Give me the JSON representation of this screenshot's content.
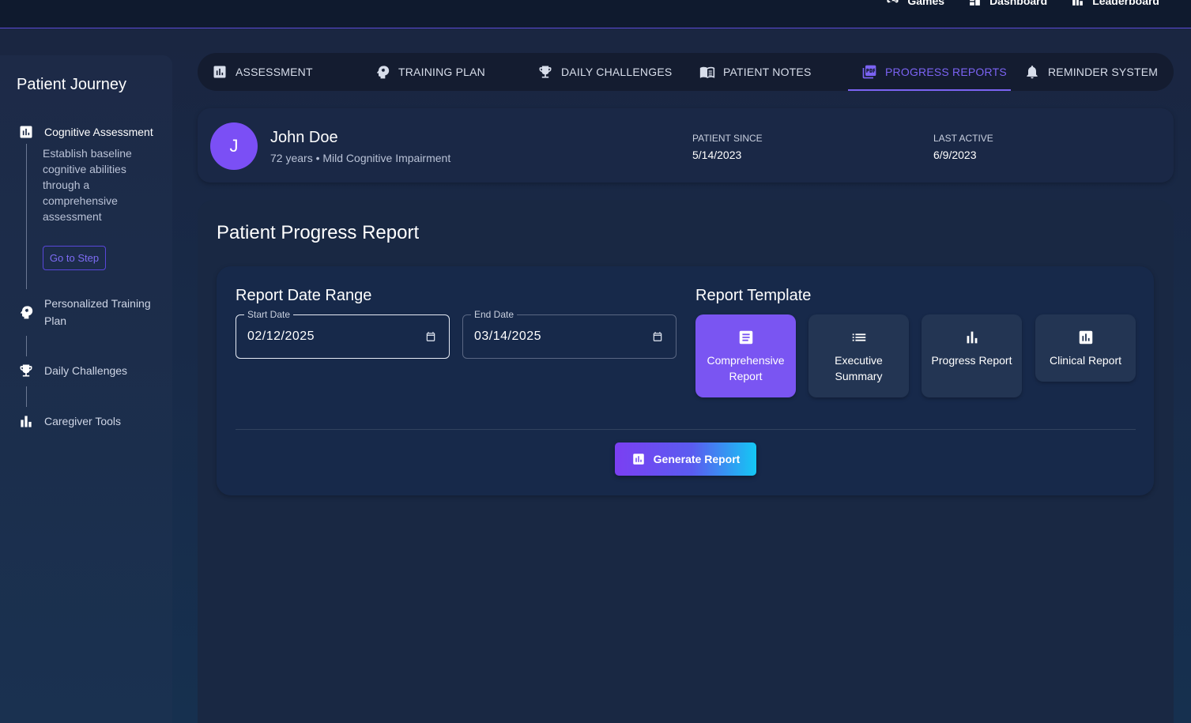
{
  "topnav": {
    "items": [
      {
        "label": "Games",
        "icon": "gamepad-icon"
      },
      {
        "label": "Dashboard",
        "icon": "dashboard-icon"
      },
      {
        "label": "Leaderboard",
        "icon": "leaderboard-icon"
      }
    ]
  },
  "sidebar": {
    "title": "Patient Journey",
    "steps": [
      {
        "label": "Cognitive Assessment",
        "icon": "chart-icon",
        "active": true,
        "description": "Establish baseline cognitive abilities through a comprehensive assessment",
        "button": "Go to Step"
      },
      {
        "label": "Personalized Training Plan",
        "icon": "brain-icon"
      },
      {
        "label": "Daily Challenges",
        "icon": "trophy-icon"
      },
      {
        "label": "Caregiver Tools",
        "icon": "bar-chart-icon"
      }
    ]
  },
  "tabs": [
    {
      "label": "ASSESSMENT",
      "icon": "assessment-icon"
    },
    {
      "label": "TRAINING PLAN",
      "icon": "brain-icon"
    },
    {
      "label": "DAILY CHALLENGES",
      "icon": "trophy-icon"
    },
    {
      "label": "PATIENT NOTES",
      "icon": "book-icon"
    },
    {
      "label": "PROGRESS REPORTS",
      "icon": "pdf-icon",
      "active": true
    },
    {
      "label": "REMINDER SYSTEM",
      "icon": "bell-icon"
    }
  ],
  "patient": {
    "initial": "J",
    "name": "John Doe",
    "subtitle": "72 years • Mild Cognitive Impairment",
    "since_label": "PATIENT SINCE",
    "since_value": "5/14/2023",
    "active_label": "LAST ACTIVE",
    "active_value": "6/9/2023"
  },
  "report": {
    "title": "Patient Progress Report",
    "date_range_title": "Report Date Range",
    "start_label": "Start Date",
    "start_value": "02/12/2025",
    "end_label": "End Date",
    "end_value": "03/14/2025",
    "template_title": "Report Template",
    "templates": [
      {
        "label": "Comprehensive Report",
        "icon": "document-icon",
        "selected": true
      },
      {
        "label": "Executive Summary",
        "icon": "list-icon"
      },
      {
        "label": "Progress Report",
        "icon": "bar-chart-icon"
      },
      {
        "label": "Clinical Report",
        "icon": "assessment-icon"
      }
    ],
    "generate_label": "Generate Report"
  },
  "colors": {
    "accent": "#7b63f3",
    "selected_template": "#7a55f2",
    "avatar": "#7b4ff5"
  }
}
